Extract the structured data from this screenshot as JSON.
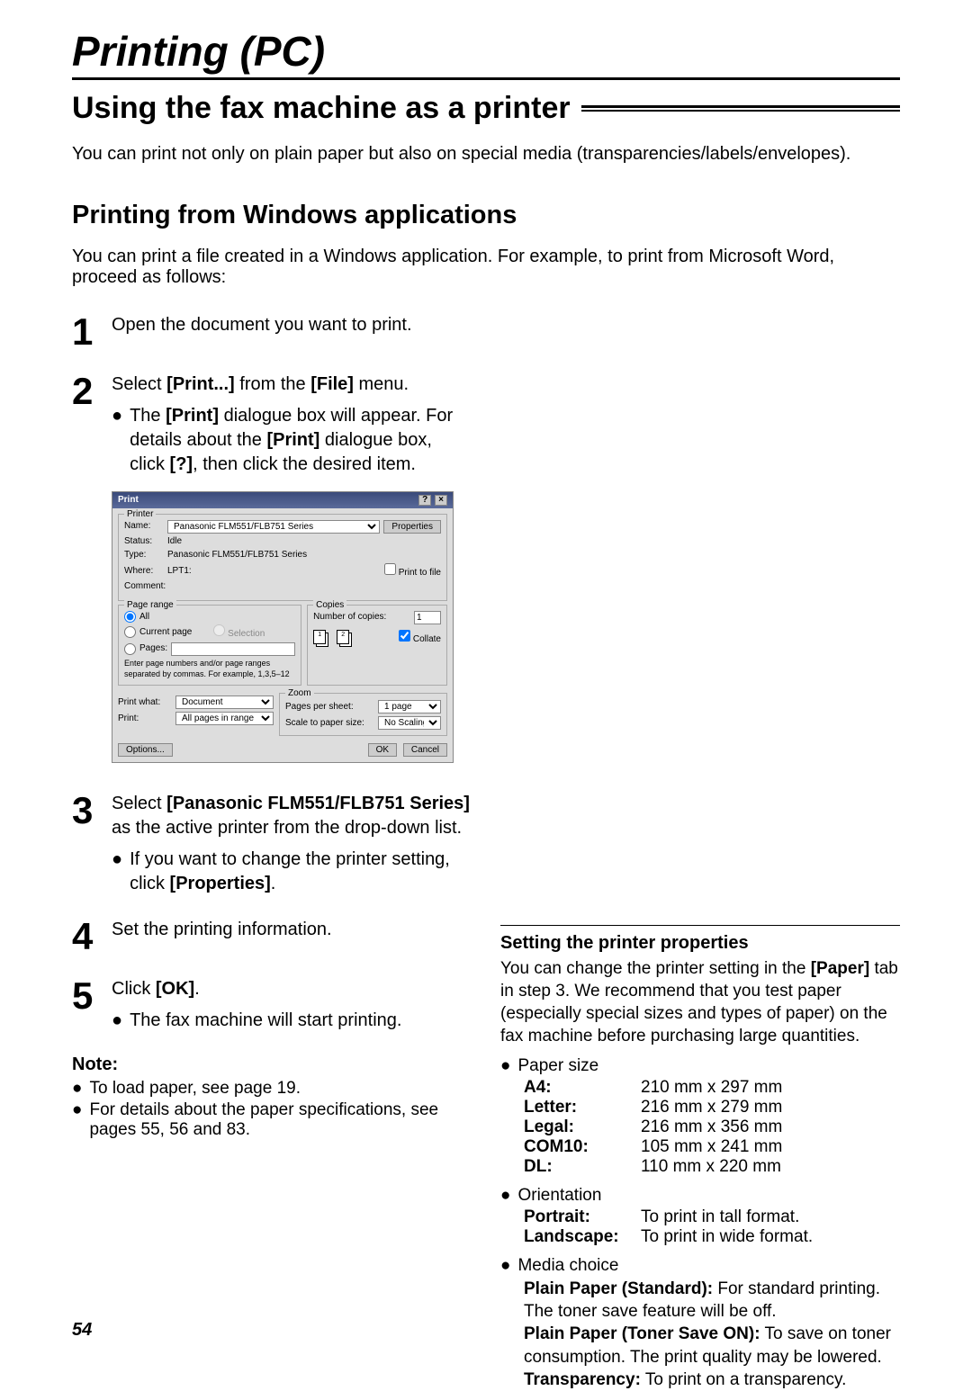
{
  "chapter": "Printing (PC)",
  "section": "Using the fax machine as a printer",
  "intro": "You can print not only on plain paper but also on special media (transparencies/labels/envelopes).",
  "sub": {
    "title": "Printing from Windows applications",
    "intro": "You can print a file created in a Windows application. For example, to print from Microsoft Word, proceed as follows:"
  },
  "steps": {
    "s1": "Open the document you want to print.",
    "s2": {
      "line": "Select [Print...] from the [File] menu.",
      "line_pre": "Select ",
      "line_b1": "[Print...]",
      "line_mid": " from the ",
      "line_b2": "[File]",
      "line_post": " menu.",
      "b1_pre": "The ",
      "b1_b": "[Print]",
      "b1_post": " dialogue box will appear. For details about the ",
      "b1_b2": "[Print]",
      "b1_post2": " dialogue box, click ",
      "b1_b3": "[?]",
      "b1_post3": ", then click the desired item."
    },
    "s3": {
      "pre": "Select ",
      "b": "[Panasonic FLM551/FLB751 Series]",
      "post": " as the active printer from the drop-down list.",
      "bul_pre": "If you want to change the printer setting, click ",
      "bul_b": "[Properties]",
      "bul_post": "."
    },
    "s4": "Set the printing information.",
    "s5": {
      "pre": "Click ",
      "b": "[OK]",
      "post": ".",
      "bul": "The fax machine will start printing."
    }
  },
  "note": {
    "heading": "Note:",
    "i1": "To load paper, see page 19.",
    "i2": "For details about the paper specifications, see pages 55, 56 and 83."
  },
  "dlg": {
    "title": "Print",
    "help": "?",
    "close": "×",
    "printer": {
      "legend": "Printer",
      "name_l": "Name:",
      "name_v": "Panasonic FLM551/FLB751 Series",
      "props": "Properties",
      "status_l": "Status:",
      "status_v": "Idle",
      "type_l": "Type:",
      "type_v": "Panasonic FLM551/FLB751 Series",
      "where_l": "Where:",
      "where_v": "LPT1:",
      "comment_l": "Comment:",
      "ptf": "Print to file"
    },
    "range": {
      "legend": "Page range",
      "all": "All",
      "cur": "Current page",
      "sel": "Selection",
      "pages": "Pages:",
      "hint": "Enter page numbers and/or page ranges separated by commas. For example, 1,3,5–12"
    },
    "copies": {
      "legend": "Copies",
      "num_l": "Number of copies:",
      "num_v": "1",
      "collate": "Collate"
    },
    "zoom": {
      "legend": "Zoom",
      "pps_l": "Pages per sheet:",
      "pps_v": "1 page",
      "sps_l": "Scale to paper size:",
      "sps_v": "No Scaling"
    },
    "pw_l": "Print what:",
    "pw_v": "Document",
    "pr_l": "Print:",
    "pr_v": "All pages in range",
    "options": "Options...",
    "ok": "OK",
    "cancel": "Cancel"
  },
  "side": {
    "h": "Setting the printer properties",
    "p_pre": "You can change the printer setting in the ",
    "p_b": "[Paper]",
    "p_post": " tab in step 3. We recommend that you test paper (especially special sizes and types of paper) on the fax machine before purchasing large quantities.",
    "paper_label": "Paper size",
    "paper": {
      "A4": "210 mm x 297 mm",
      "Letter": "216 mm x 279 mm",
      "Legal": "216 mm x 356 mm",
      "COM10": "105 mm x 241 mm",
      "DL": "110 mm x 220 mm",
      "k_A4": "A4:",
      "k_Letter": "Letter:",
      "k_Legal": "Legal:",
      "k_COM10": "COM10:",
      "k_DL": "DL:"
    },
    "orient_label": "Orientation",
    "orient": {
      "k_portrait": "Portrait:",
      "portrait": "To print in tall format.",
      "k_landscape": "Landscape:",
      "landscape": "To print in wide format."
    },
    "media_label": "Media choice",
    "media": {
      "k1": "Plain Paper (Standard):",
      "v1": " For standard printing. The toner save feature will be off.",
      "k2": "Plain Paper (Toner Save ON):",
      "v2": " To save on toner consumption. The print quality may be lowered.",
      "k3": "Transparency:",
      "v3": " To print on a transparency."
    }
  },
  "page_number": "54"
}
